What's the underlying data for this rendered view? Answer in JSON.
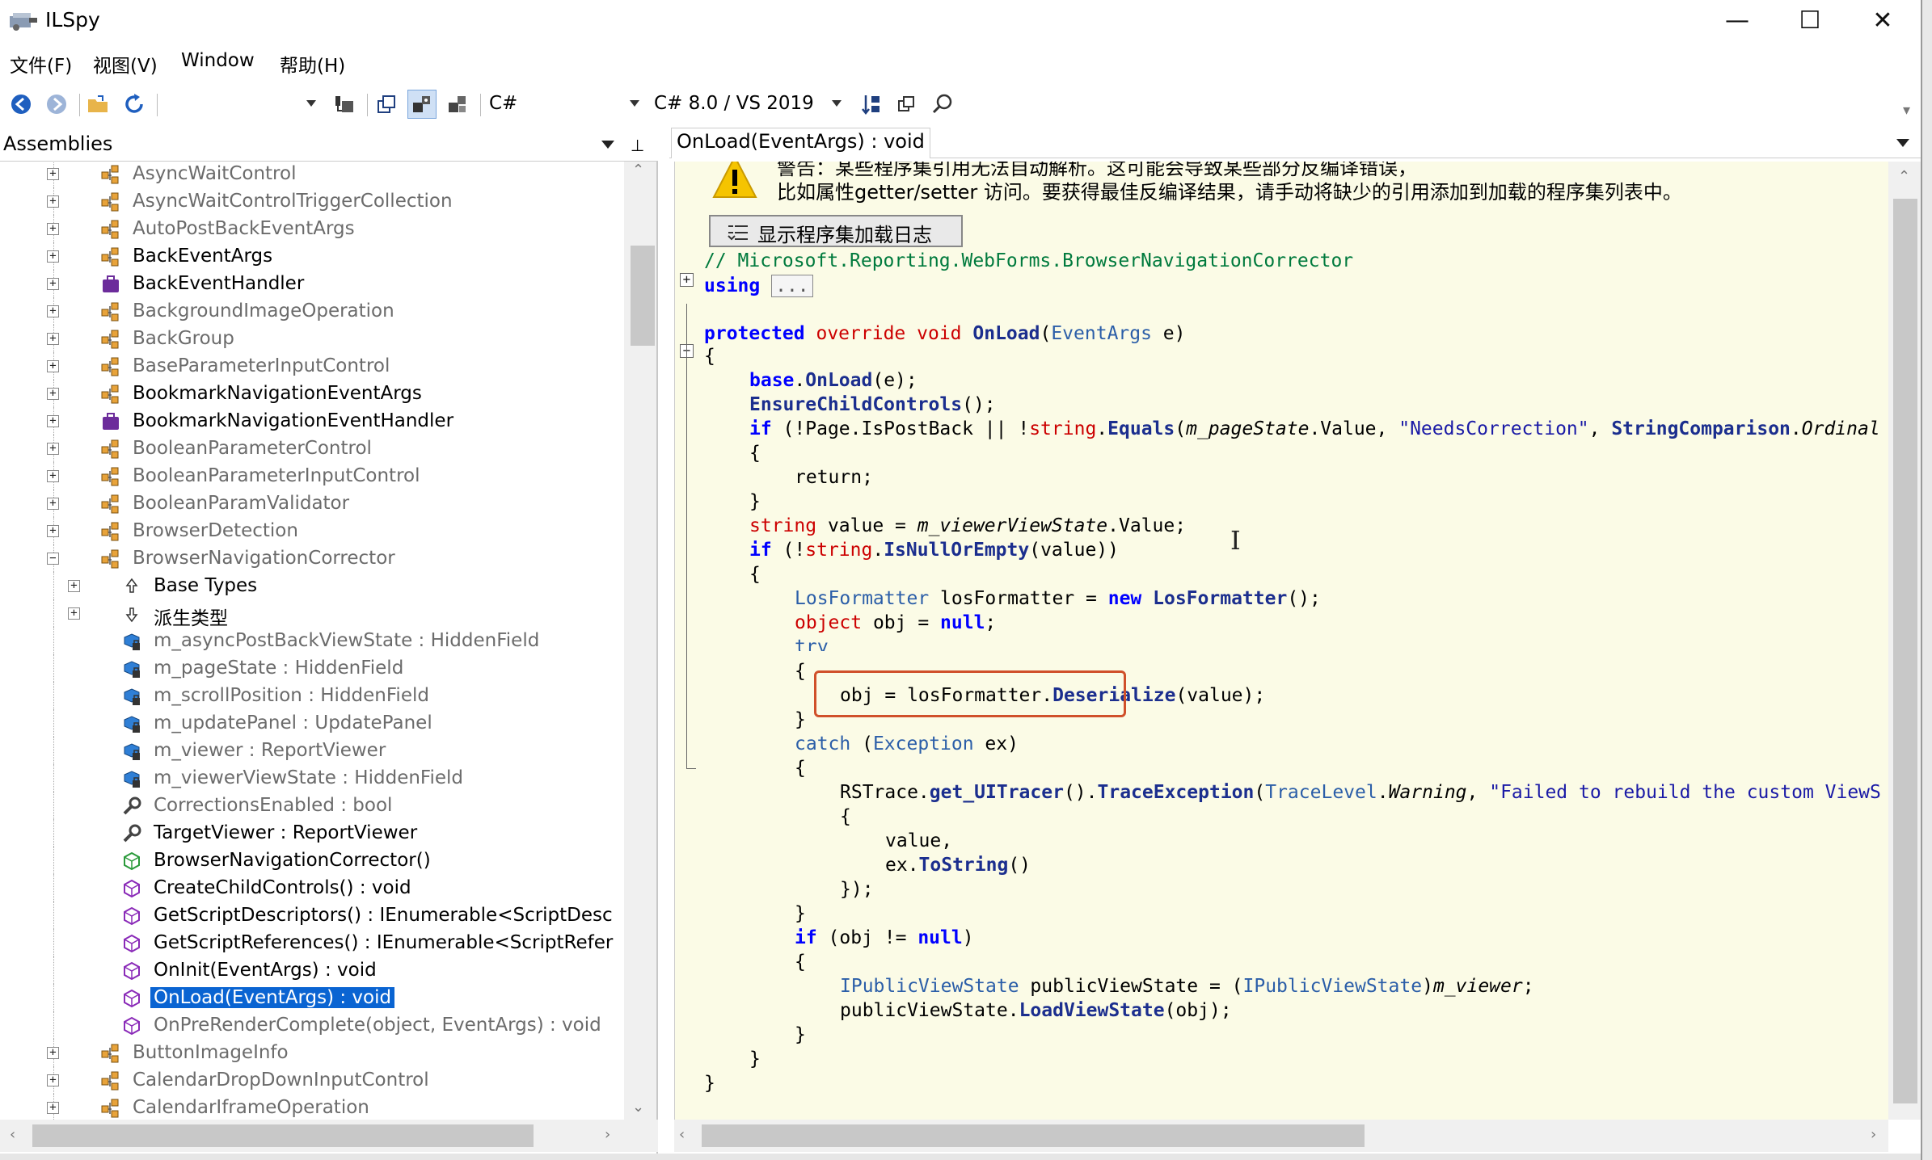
{
  "window": {
    "title": "ILSpy",
    "minimize": "—",
    "maximize": "☐",
    "close": "✕"
  },
  "menu": [
    "文件(F)",
    "视图(V)",
    "Window",
    "帮助(H)"
  ],
  "toolbar": {
    "language": "C#",
    "version": "C# 8.0 / VS 2019"
  },
  "left_pane": {
    "title": "Assemblies",
    "pin": "⊥"
  },
  "tree": [
    {
      "label": "AsyncWaitControl",
      "depth": 0,
      "icon": "class-icon",
      "style": "gray",
      "expander": "+"
    },
    {
      "label": "AsyncWaitControlTriggerCollection",
      "depth": 0,
      "icon": "class-icon",
      "style": "gray",
      "expander": "+"
    },
    {
      "label": "AutoPostBackEventArgs",
      "depth": 0,
      "icon": "class-icon",
      "style": "gray",
      "expander": "+"
    },
    {
      "label": "BackEventArgs",
      "depth": 0,
      "icon": "class-icon",
      "style": "dark",
      "expander": "+"
    },
    {
      "label": "BackEventHandler",
      "depth": 0,
      "icon": "delegate-icon",
      "style": "dark",
      "expander": "+"
    },
    {
      "label": "BackgroundImageOperation",
      "depth": 0,
      "icon": "class-icon",
      "style": "gray",
      "expander": "+"
    },
    {
      "label": "BackGroup",
      "depth": 0,
      "icon": "class-icon",
      "style": "gray",
      "expander": "+"
    },
    {
      "label": "BaseParameterInputControl",
      "depth": 0,
      "icon": "class-icon",
      "style": "gray",
      "expander": "+"
    },
    {
      "label": "BookmarkNavigationEventArgs",
      "depth": 0,
      "icon": "class-icon",
      "style": "dark",
      "expander": "+"
    },
    {
      "label": "BookmarkNavigationEventHandler",
      "depth": 0,
      "icon": "delegate-icon",
      "style": "dark",
      "expander": "+"
    },
    {
      "label": "BooleanParameterControl",
      "depth": 0,
      "icon": "class-icon",
      "style": "gray",
      "expander": "+"
    },
    {
      "label": "BooleanParameterInputControl",
      "depth": 0,
      "icon": "class-icon",
      "style": "gray",
      "expander": "+"
    },
    {
      "label": "BooleanParamValidator",
      "depth": 0,
      "icon": "class-icon",
      "style": "gray",
      "expander": "+"
    },
    {
      "label": "BrowserDetection",
      "depth": 0,
      "icon": "class-icon",
      "style": "gray",
      "expander": "+"
    },
    {
      "label": "BrowserNavigationCorrector",
      "depth": 0,
      "icon": "class-icon",
      "style": "gray",
      "expander": "-"
    },
    {
      "label": "Base Types",
      "depth": 1,
      "icon": "base-types-icon",
      "style": "dark",
      "expander": "+"
    },
    {
      "label": "派生类型",
      "depth": 1,
      "icon": "derived-types-icon",
      "style": "dark",
      "expander": "+"
    },
    {
      "label": "m_asyncPostBackViewState : HiddenField",
      "depth": 1,
      "icon": "field-icon",
      "style": "gray",
      "expander": ""
    },
    {
      "label": "m_pageState : HiddenField",
      "depth": 1,
      "icon": "field-icon",
      "style": "gray",
      "expander": ""
    },
    {
      "label": "m_scrollPosition : HiddenField",
      "depth": 1,
      "icon": "field-icon",
      "style": "gray",
      "expander": ""
    },
    {
      "label": "m_updatePanel : UpdatePanel",
      "depth": 1,
      "icon": "field-icon",
      "style": "gray",
      "expander": ""
    },
    {
      "label": "m_viewer : ReportViewer",
      "depth": 1,
      "icon": "field-icon",
      "style": "gray",
      "expander": ""
    },
    {
      "label": "m_viewerViewState : HiddenField",
      "depth": 1,
      "icon": "field-icon",
      "style": "gray",
      "expander": ""
    },
    {
      "label": "CorrectionsEnabled : bool",
      "depth": 1,
      "icon": "property-icon",
      "style": "gray",
      "expander": ""
    },
    {
      "label": "TargetViewer : ReportViewer",
      "depth": 1,
      "icon": "property-icon",
      "style": "dark",
      "expander": ""
    },
    {
      "label": "BrowserNavigationCorrector()",
      "depth": 1,
      "icon": "method-icon",
      "style": "dark",
      "expander": ""
    },
    {
      "label": "CreateChildControls() : void",
      "depth": 1,
      "icon": "method-icon",
      "style": "dark",
      "expander": ""
    },
    {
      "label": "GetScriptDescriptors() : IEnumerable<ScriptDesc",
      "depth": 1,
      "icon": "method-icon",
      "style": "dark",
      "expander": ""
    },
    {
      "label": "GetScriptReferences() : IEnumerable<ScriptRefer",
      "depth": 1,
      "icon": "method-icon",
      "style": "dark",
      "expander": ""
    },
    {
      "label": "OnInit(EventArgs) : void",
      "depth": 1,
      "icon": "method-icon",
      "style": "dark",
      "expander": ""
    },
    {
      "label": "OnLoad(EventArgs) : void",
      "depth": 1,
      "icon": "method-icon",
      "style": "sel",
      "expander": ""
    },
    {
      "label": "OnPreRenderComplete(object, EventArgs) : void",
      "depth": 1,
      "icon": "method-icon",
      "style": "gray",
      "expander": ""
    },
    {
      "label": "ButtonImageInfo",
      "depth": 0,
      "icon": "class-icon",
      "style": "gray",
      "expander": "+"
    },
    {
      "label": "CalendarDropDownInputControl",
      "depth": 0,
      "icon": "class-icon",
      "style": "gray",
      "expander": "+"
    },
    {
      "label": "CalendarIframeOperation",
      "depth": 0,
      "icon": "class-icon",
      "style": "gray",
      "expander": "+"
    }
  ],
  "tab": {
    "label": "OnLoad(EventArgs) : void"
  },
  "warning": {
    "line1": "警告：某些程序集引用无法自动解析。这可能会导致某些部分反编译错误，",
    "line2": "比如属性getter/setter 访问。要获得最佳反编译结果，请手动将缺少的引用添加到加载的程序集列表中。",
    "button": "显示程序集加载日志"
  },
  "code": {
    "comment": "// Microsoft.Reporting.WebForms.BrowserNavigationCorrector",
    "using_kw": "using",
    "using_ellipsis": "...",
    "l_sig": {
      "a": "protected",
      "b": "override",
      "c": "void",
      "d": "OnLoad",
      "e": "(",
      "f": "EventArgs",
      "g": " e)"
    },
    "brace_open": "{",
    "brace_close": "}",
    "l_base": {
      "a": "base",
      "b": ".",
      "c": "OnLoad",
      "d": "(e);"
    },
    "l_ensure": {
      "a": "EnsureChildControls",
      "b": "();"
    },
    "l_if1": {
      "a": "if",
      "b": " (!Page.IsPostBack || !",
      "c": "string",
      "d": ".",
      "e": "Equals",
      "f": "(",
      "g": "m_pageState",
      "h": ".Value, ",
      "i": "\"NeedsCorrection\"",
      "j": ", ",
      "k": "StringComparison",
      "l": ".",
      "m": "Ordinal"
    },
    "l_return": "return;",
    "l_string": {
      "a": "string",
      "b": " value = ",
      "c": "m_viewerViewState",
      "d": ".Value;"
    },
    "l_if2": {
      "a": "if",
      "b": " (!",
      "c": "string",
      "d": ".",
      "e": "IsNullOrEmpty",
      "f": "(value))"
    },
    "l_los": {
      "a": "LosFormatter",
      "b": " losFormatter = ",
      "c": "new",
      "d": " ",
      "e": "LosFormatter",
      "f": "();"
    },
    "l_obj": {
      "a": "object",
      "b": " obj = ",
      "c": "null",
      "d": ";"
    },
    "l_try": "try",
    "l_deser": {
      "a": "obj = losFormatter.",
      "b": "Deserialize",
      "c": "(value);"
    },
    "l_catch": {
      "a": "catch",
      "b": " (",
      "c": "Exception",
      "d": " ex)"
    },
    "l_trace": {
      "a": "RSTrace.",
      "b": "get_UITracer",
      "c": "().",
      "d": "TraceException",
      "e": "(",
      "f": "TraceLevel",
      "g": ".",
      "h": "Warning",
      "i": ", ",
      "j": "\"Failed to rebuild the custom ViewS"
    },
    "l_value": "value,",
    "l_tostring": {
      "a": "ex.",
      "b": "ToString",
      "c": "()"
    },
    "l_end": "});",
    "l_if3": {
      "a": "if",
      "b": " (obj != ",
      "c": "null",
      "d": ")"
    },
    "l_ipub": {
      "a": "IPublicViewState",
      "b": " publicViewState = (",
      "c": "IPublicViewState",
      "d": ")",
      "e": "m_viewer",
      "f": ";"
    },
    "l_load": {
      "a": "publicViewState.",
      "b": "LoadViewState",
      "c": "(obj);"
    }
  },
  "colors": {
    "selection": "#0a64d2",
    "code_bg": "#fbfbe6",
    "highlight_box": "#d0502a"
  }
}
